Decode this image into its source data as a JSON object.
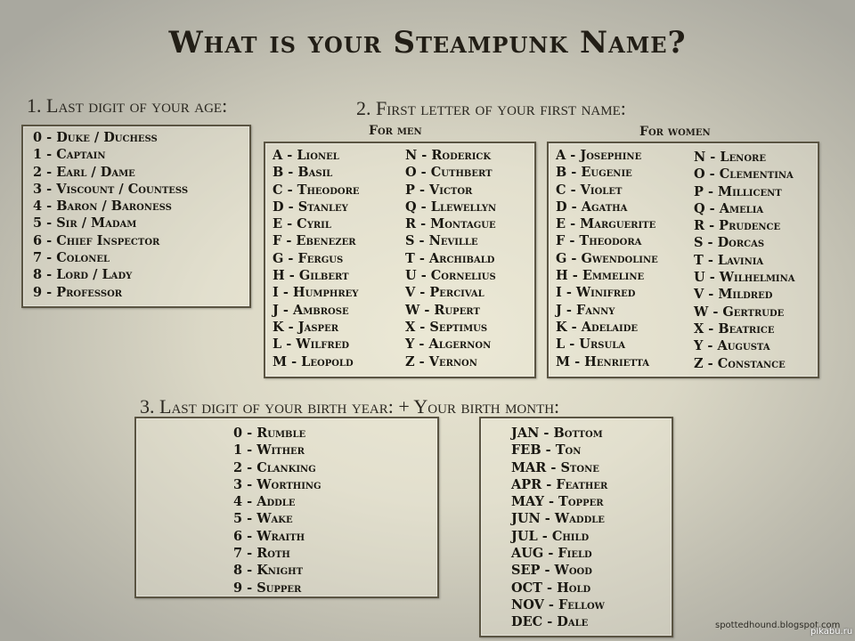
{
  "title": "What is your Steampunk Name?",
  "section1": {
    "heading": "1. Last digit of your age:",
    "items": [
      "0 - Duke / Duchess",
      "1 - Captain",
      "2 - Earl / Dame",
      "3 - Viscount / Countess",
      "4 - Baron / Baroness",
      "5 - Sir / Madam",
      "6 - Chief Inspector",
      "7 - Colonel",
      "8 - Lord / Lady",
      "9 - Professor"
    ]
  },
  "section2": {
    "heading": "2. First letter of your first name:",
    "men": {
      "label": "For men",
      "col1": [
        "A - Lionel",
        "B - Basil",
        "C - Theodore",
        "D - Stanley",
        "E - Cyril",
        "F - Ebenezer",
        "G - Fergus",
        "H - Gilbert",
        "I - Humphrey",
        "J - Ambrose",
        "K - Jasper",
        "L - Wilfred",
        "M - Leopold"
      ],
      "col2": [
        "N - Roderick",
        "O - Cuthbert",
        "P - Victor",
        "Q - Llewellyn",
        "R - Montague",
        "S - Neville",
        "T - Archibald",
        "U - Cornelius",
        "V - Percival",
        "W - Rupert",
        "X - Septimus",
        "Y - Algernon",
        "Z - Vernon"
      ]
    },
    "women": {
      "label": "For women",
      "col1": [
        "A - Josephine",
        "B - Eugenie",
        "C - Violet",
        "D - Agatha",
        "E - Marguerite",
        "F - Theodora",
        "G - Gwendoline",
        "H - Emmeline",
        "I - Winifred",
        "J - Fanny",
        "K - Adelaide",
        "L - Ursula",
        "M - Henrietta"
      ],
      "col2": [
        "N - Lenore",
        "O - Clementina",
        "P - Millicent",
        "Q - Amelia",
        "R - Prudence",
        "S - Dorcas",
        "T - Lavinia",
        "U - Wilhelmina",
        "V - Mildred",
        "W - Gertrude",
        "X - Beatrice",
        "Y - Augusta",
        "Z - Constance"
      ]
    }
  },
  "section3": {
    "heading": "3. Last digit of your birth year: + Your birth month:",
    "year_items": [
      "0 - Rumble",
      "1 - Wither",
      "2 - Clanking",
      "3 - Worthing",
      "4 - Addle",
      "5 - Wake",
      "6 - Wraith",
      "7 - Roth",
      "8 - Knight",
      "9 - Supper"
    ],
    "month_items": [
      "JAN - Bottom",
      "FEB - Ton",
      "MAR - Stone",
      "APR - Feather",
      "MAY - Topper",
      "JUN - Waddle",
      "JUL - Child",
      "AUG - Field",
      "SEP - Wood",
      "OCT - Hold",
      "NOV - Fellow",
      "DEC - Dale"
    ]
  },
  "credit": "spottedhound.blogspot.com",
  "watermark": "pikabu.ru"
}
